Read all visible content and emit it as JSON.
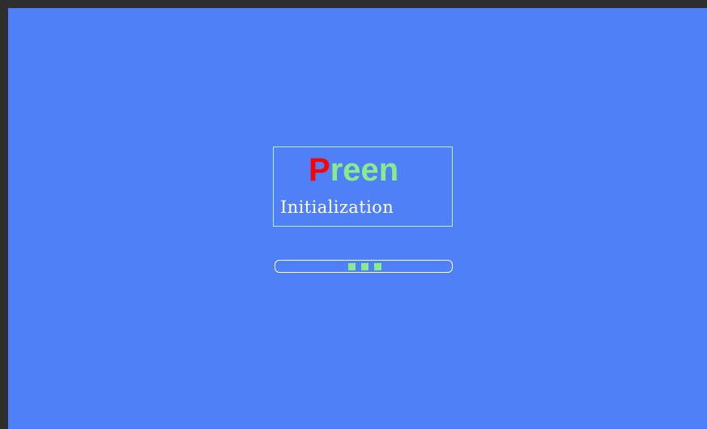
{
  "splash": {
    "logo_first_letter": "P",
    "logo_rest": "reen",
    "subtitle": "Initialization"
  },
  "progress": {
    "state": "indeterminate",
    "block_count": 3,
    "block_color": "#88ec8c"
  },
  "colors": {
    "background": "#5080f8",
    "logo_first": "#ff0000",
    "logo_rest": "#88ec8c",
    "frame": "#2e2e2e"
  }
}
